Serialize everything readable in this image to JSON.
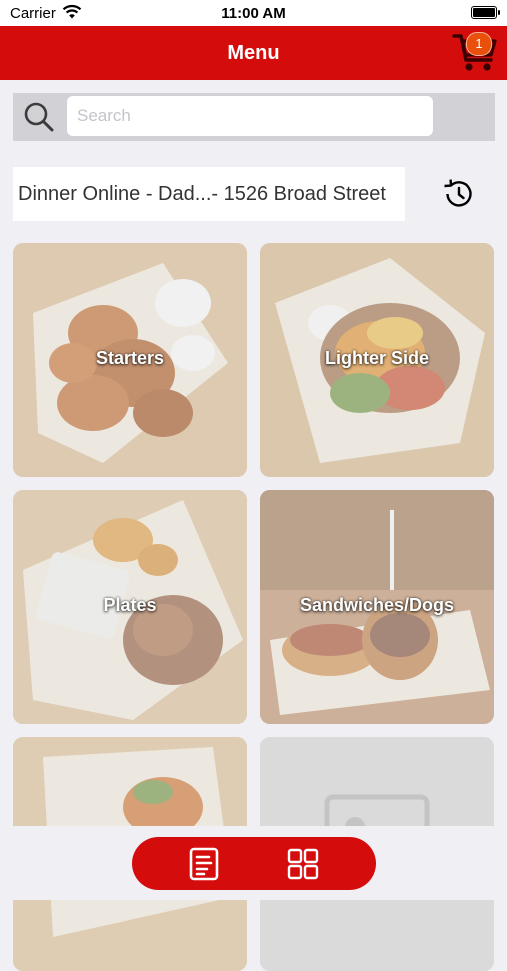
{
  "status_bar": {
    "carrier": "Carrier",
    "time": "11:00 AM"
  },
  "nav": {
    "title": "Menu",
    "cart_count": "1"
  },
  "search": {
    "placeholder": "Search",
    "value": ""
  },
  "location": {
    "text": "Dinner Online - Dad...- 1526 Broad Street"
  },
  "categories": [
    {
      "label": "Starters"
    },
    {
      "label": "Lighter Side"
    },
    {
      "label": "Plates"
    },
    {
      "label": "Sandwiches/Dogs"
    },
    {
      "label": ""
    },
    {
      "label": ""
    }
  ],
  "colors": {
    "brand_red": "#d40c0c",
    "background": "#efeff4",
    "badge": "#e8500c"
  },
  "icons": [
    "wifi-icon",
    "battery-icon",
    "cart-icon",
    "search-icon",
    "history-icon",
    "list-view-icon",
    "grid-view-icon"
  ]
}
